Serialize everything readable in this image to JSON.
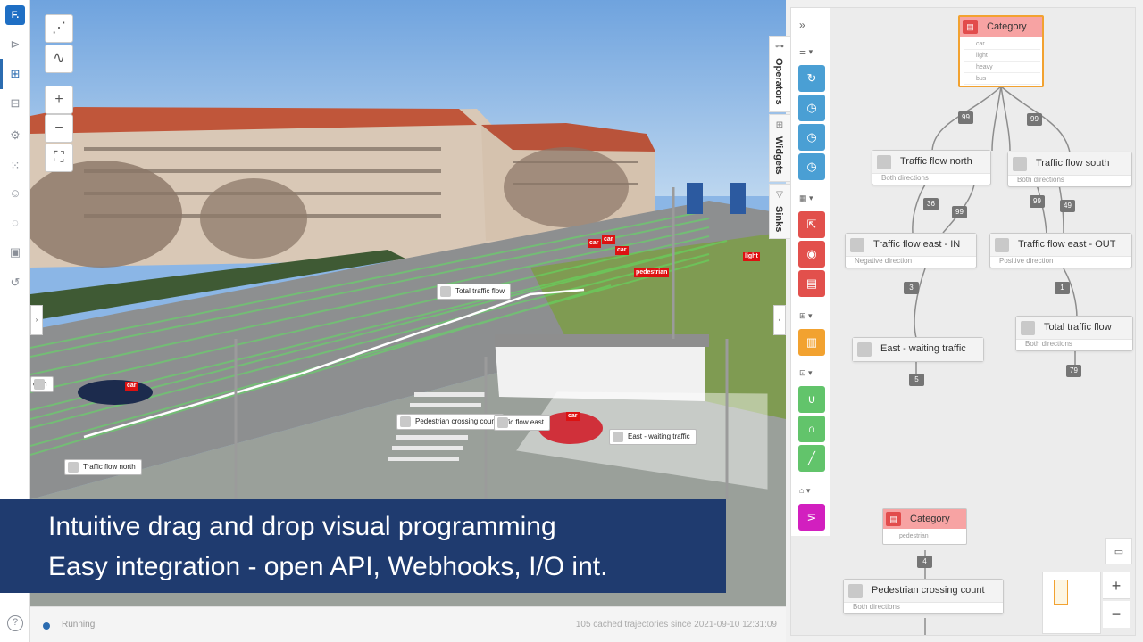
{
  "app": {
    "logo": "F."
  },
  "rail": {
    "icons": [
      "collapse-toggle-icon",
      "flow-editor-icon",
      "widgets-icon",
      "settings-cog-icon",
      "grid-icon",
      "users-icon",
      "bell-icon",
      "devices-icon",
      "history-icon",
      "help-icon"
    ],
    "help_glyph": "?"
  },
  "scene_tools": {
    "zoom_in": "+",
    "zoom_out": "−",
    "fit": "⛶",
    "panel_toggle": "‹",
    "left_toggle": "›"
  },
  "zones": {
    "total_flow": "Total traffic flow",
    "ped_count": "Pedestrian crossing count",
    "east_wait": "East - waiting traffic",
    "flow_north": "Traffic flow north",
    "flow_east_partial": "raffic flow east",
    "south_partial": "outh"
  },
  "detections": [
    "car",
    "car",
    "car",
    "light",
    "pedestrian",
    "car",
    "car"
  ],
  "banner": {
    "line1": "Intuitive drag and drop visual programming",
    "line2": "Easy integration - open API, Webhooks, I/O int."
  },
  "status": {
    "state": "Running",
    "info": "105 cached trajectories since 2021-09-10 12:31:09"
  },
  "tabs": {
    "operators": "Operators",
    "widgets": "Widgets",
    "sinks": "Sinks"
  },
  "palette": {
    "expand": "»",
    "colors": {
      "blue": "#4a9fd4",
      "red": "#e2504c",
      "orange": "#f2a230",
      "green": "#62c46b",
      "magenta": "#d21fbf"
    },
    "glyphs": {
      "blue1": "↻",
      "blue2": "◷",
      "blue3": "◷",
      "blue4": "◷",
      "red1": "⇱",
      "red2": "◉",
      "red3": "▤",
      "orange1": "▥",
      "green1": "∪",
      "green2": "∩",
      "green3": "╱",
      "mag1": "⋝"
    }
  },
  "flow": {
    "category_top": {
      "title": "Category",
      "items": [
        "car",
        "light",
        "heavy",
        "bus"
      ]
    },
    "category_bottom": {
      "title": "Category",
      "items": [
        "pedestrian"
      ]
    },
    "nodes": {
      "north": {
        "title": "Traffic flow north",
        "sub": "Both directions"
      },
      "south": {
        "title": "Traffic flow south",
        "sub": "Both directions"
      },
      "east_in": {
        "title": "Traffic flow east - IN",
        "sub": "Negative direction"
      },
      "east_out": {
        "title": "Traffic flow east - OUT",
        "sub": "Positive direction"
      },
      "east_wait": {
        "title": "East - waiting traffic"
      },
      "total": {
        "title": "Total traffic flow",
        "sub": "Both directions"
      },
      "ped": {
        "title": "Pedestrian crossing count",
        "sub": "Both directions"
      }
    },
    "badges": {
      "b99a": "99",
      "b99b": "99",
      "b36": "36",
      "b99c": "99",
      "b99d": "99",
      "b49": "49",
      "b3": "3",
      "b1": "1",
      "b5": "5",
      "b79": "79",
      "b4": "4"
    },
    "zoom_in": "+",
    "zoom_out": "−",
    "comment": "▭"
  }
}
